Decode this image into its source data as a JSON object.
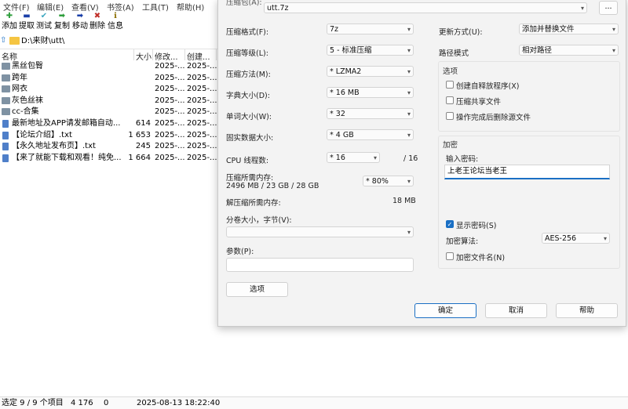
{
  "menubar": [
    "文件(F)",
    "编辑(E)",
    "查看(V)",
    "书签(A)",
    "工具(T)",
    "帮助(H)"
  ],
  "toolbar": [
    {
      "label": "添加",
      "icon": "plus-icon",
      "glyph": "✚",
      "color": "#2e9e3c"
    },
    {
      "label": "提取",
      "icon": "minus-icon",
      "glyph": "▬",
      "color": "#1a3fa8"
    },
    {
      "label": "测试",
      "icon": "check-icon",
      "glyph": "✔",
      "color": "#3fa8c0"
    },
    {
      "label": "复制",
      "icon": "arrow-right-icon",
      "glyph": "➡",
      "color": "#2e9e3c"
    },
    {
      "label": "移动",
      "icon": "move-arrow-icon",
      "glyph": "➡",
      "color": "#1a3fa8"
    },
    {
      "label": "删除",
      "icon": "delete-x-icon",
      "glyph": "✖",
      "color": "#c0302a"
    },
    {
      "label": "信息",
      "icon": "info-icon",
      "glyph": "ℹ",
      "color": "#8a6d00"
    }
  ],
  "address": {
    "path": "D:\\来财\\utt\\"
  },
  "columns": {
    "name": "名称",
    "size": "大小",
    "modified": "修改...",
    "created": "创建..."
  },
  "files": [
    {
      "name": "黑丝包臀",
      "size": "",
      "modified": "2025-...",
      "created": "2025-...",
      "type": "folder"
    },
    {
      "name": "跨年",
      "size": "",
      "modified": "2025-...",
      "created": "2025-...",
      "type": "folder"
    },
    {
      "name": "网衣",
      "size": "",
      "modified": "2025-...",
      "created": "2025-...",
      "type": "folder"
    },
    {
      "name": "灰色丝袜",
      "size": "",
      "modified": "2025-...",
      "created": "2025-...",
      "type": "folder"
    },
    {
      "name": "cc-合集",
      "size": "",
      "modified": "2025-...",
      "created": "2025-...",
      "type": "folder"
    },
    {
      "name": "最新地址及APP请发邮箱自动...",
      "size": "614",
      "modified": "2025-...",
      "created": "2025-...",
      "type": "txt"
    },
    {
      "name": "【论坛介绍】.txt",
      "size": "1 653",
      "modified": "2025-...",
      "created": "2025-...",
      "type": "txt"
    },
    {
      "name": "【永久地址发布页】.txt",
      "size": "245",
      "modified": "2025-...",
      "created": "2025-...",
      "type": "txt"
    },
    {
      "name": "【来了就能下载和观看！纯免...",
      "size": "1 664",
      "modified": "2025-...",
      "created": "2025-...",
      "type": "txt"
    }
  ],
  "status": {
    "selection": "选定 9 / 9 个项目",
    "size": "4 176",
    "zero": "0",
    "datetime": "2025-08-13 18:22:40"
  },
  "dialog": {
    "archive_label": "压缩包(A):",
    "archive_value": "utt.7z",
    "browse_label": "...",
    "format_label": "压缩格式(F):",
    "format_value": "7z",
    "level_label": "压缩等级(L):",
    "level_value": "5 - 标准压缩",
    "method_label": "压缩方法(M):",
    "method_value": "* LZMA2",
    "dict_label": "字典大小(D):",
    "dict_value": "* 16 MB",
    "word_label": "单词大小(W):",
    "word_value": "* 32",
    "solid_label": "固实数据大小:",
    "solid_value": "* 4 GB",
    "cpu_label": "CPU 线程数:",
    "cpu_value": "* 16",
    "cpu_max": "/ 16",
    "mem_compress_label": "压缩所需内存:",
    "mem_compress_value": "2496 MB / 23 GB / 28 GB",
    "mem_percent": "* 80%",
    "mem_decompress_label": "解压缩所需内存:",
    "mem_decompress_value": "18 MB",
    "split_label": "分卷大小，字节(V):",
    "split_value": "",
    "params_label": "参数(P):",
    "params_value": "",
    "options_button": "选项",
    "update_label": "更新方式(U):",
    "update_value": "添加并替换文件",
    "path_label": "路径模式",
    "path_value": "相对路径",
    "options_group": "选项",
    "sfx_label": "创建自释放程序(X)",
    "shared_label": "压缩共享文件",
    "delete_label": "操作完成后删除源文件",
    "encrypt_group": "加密",
    "password_label": "输入密码:",
    "password_value": "上老王论坛当老王",
    "show_password_label": "显示密码(S)",
    "enc_method_label": "加密算法:",
    "enc_method_value": "AES-256",
    "encrypt_names_label": "加密文件名(N)",
    "ok": "确定",
    "cancel": "取消",
    "help": "帮助"
  }
}
